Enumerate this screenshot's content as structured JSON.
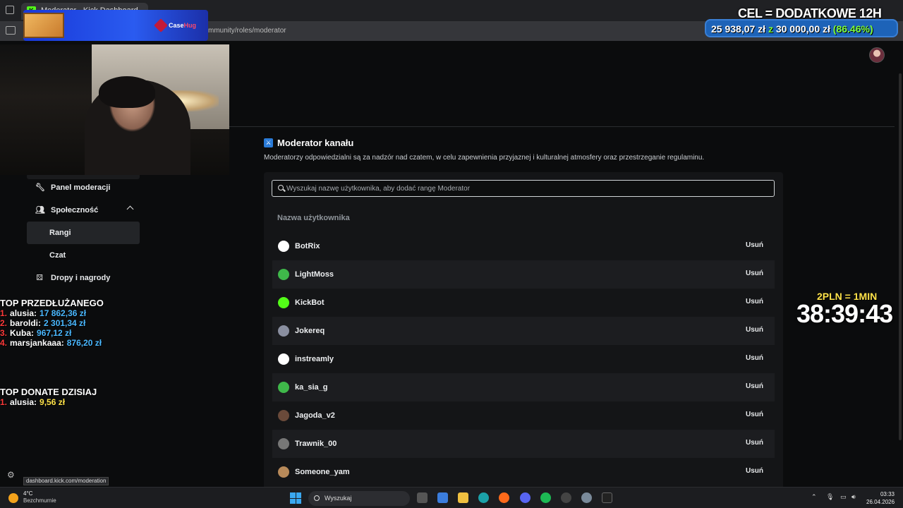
{
  "browser": {
    "tab_title": "Moderator - Kick Dashboard",
    "url": "mmunity/roles/moderator",
    "status_url": "dashboard.kick.com/moderation"
  },
  "nav": {
    "items": [
      {
        "label": "Panel moderacji",
        "icon": "wrench-icon"
      },
      {
        "label": "Społeczność",
        "icon": "users-icon",
        "expanded": true
      },
      {
        "label": "Rangi",
        "sub": true,
        "active": true
      },
      {
        "label": "Czat",
        "sub": true
      },
      {
        "label": "Dropy i nagrody",
        "icon": "gift-icon"
      }
    ]
  },
  "main": {
    "title": "Moderator kanału",
    "description": "Moderatorzy odpowiedzialni są za nadzór nad czatem, w celu zapewnienia przyjaznej i kulturalnej atmosfery oraz przestrzeganie regulaminu.",
    "search_placeholder": "Wyszukaj nazwę użytkownika, aby dodać rangę Moderator",
    "column_header": "Nazwa użytkownika",
    "remove_label": "Usuń",
    "users": [
      {
        "name": "BotRix",
        "avatar_color": "#ffffff"
      },
      {
        "name": "LightMoss",
        "avatar_color": "#3fb84a"
      },
      {
        "name": "KickBot",
        "avatar_color": "#53fc18"
      },
      {
        "name": "Jokereq",
        "avatar_color": "#8a8fa0"
      },
      {
        "name": "instreamly",
        "avatar_color": "#ffffff"
      },
      {
        "name": "ka_sia_g",
        "avatar_color": "#3fb84a"
      },
      {
        "name": "Jagoda_v2",
        "avatar_color": "#6a4a3a"
      },
      {
        "name": "Trawnik_00",
        "avatar_color": "#777777"
      },
      {
        "name": "Someone_yam",
        "avatar_color": "#b88a5a"
      }
    ]
  },
  "overlay": {
    "goal_title": "CEL = DODATKOWE 12H",
    "goal_current": "25 938,07 zł",
    "goal_sep": "z",
    "goal_target": "30 000,00 zł",
    "goal_pct": "(86.46%)",
    "timer_rate": "2PLN = 1MIN",
    "timer": "38:39:43",
    "ad_brand_a": "Case",
    "ad_brand_b": "Hug",
    "top_extend_title": "TOP PRZEDŁUŻANEGO",
    "top_extend": [
      {
        "rank": "1.",
        "name": "alusia:",
        "amount": "17 862,36 zł"
      },
      {
        "rank": "2.",
        "name": "baroldi:",
        "amount": "2 301,34 zł"
      },
      {
        "rank": "3.",
        "name": "Kuba:",
        "amount": "967,12 zł"
      },
      {
        "rank": "4.",
        "name": "marsjankaaa:",
        "amount": "876,20 zł"
      }
    ],
    "top_donate_title": "TOP DONATE DZISIAJ",
    "top_donate": [
      {
        "rank": "1.",
        "name": "alusia:",
        "amount": "9,56 zł"
      }
    ]
  },
  "taskbar": {
    "weather_temp": "4°C",
    "weather_desc": "Bezchmurnie",
    "search_label": "Wyszukaj",
    "time": "03:33",
    "date": "26.04.2026"
  },
  "colors": {
    "accent": "#53fc18",
    "page_bg": "#0b0c0d",
    "panel_bg": "#141517"
  }
}
